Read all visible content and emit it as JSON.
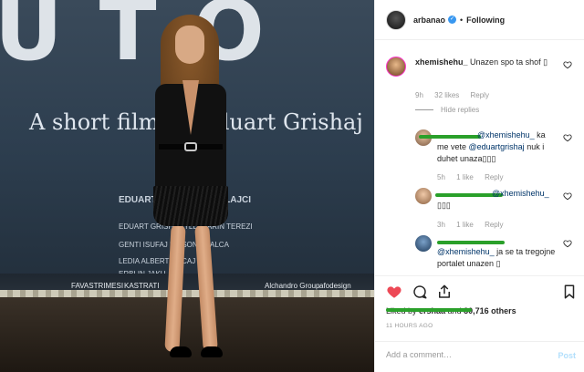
{
  "photo": {
    "banner_text": "A short film by Eduart Grishaj",
    "big_letters": "U T O",
    "credit_a": "EDUART GRISHAJ   CUN LAJCI",
    "credit_b": "EDUART GRISHAJ   YLLI   MARIN TEREZI",
    "credit_c": "GENTI ISUFAJ   EDISON SHALCA",
    "credit_d": "LEDIA   ALBERT KOCAJ",
    "credit_e": "ERBLIN JAKU",
    "sponsors": [
      "FAVASTRIMESI",
      "KASTRATI",
      "Alchandro Group",
      "afodesign"
    ]
  },
  "header": {
    "username": "arbanao",
    "verified_mark": "✓",
    "separator": "•",
    "follow_label": "Following"
  },
  "comments": [
    {
      "user": "xhemishehu_",
      "text": "Unazen spo ta shof",
      "emoji": "▯",
      "time": "9h",
      "likes": "32 likes",
      "reply": "Reply",
      "hide_replies": "Hide replies"
    }
  ],
  "replies": [
    {
      "mention": "@xhemishehu_",
      "text_a": " ka me vete ",
      "mention2": "@eduartgrishaj",
      "text_b": " nuk i duhet unaza",
      "emoji": "▯▯▯",
      "time": "5h",
      "likes": "1 like",
      "reply": "Reply"
    },
    {
      "mention": "@xhemishehu_",
      "emoji": "▯▯▯",
      "time": "3h",
      "likes": "1 like",
      "reply": "Reply"
    },
    {
      "mention": "@xhemishehu_",
      "text": " ja se ta tregojne portalet unazen",
      "emoji": "▯"
    }
  ],
  "likes": {
    "prefix": "Liked by",
    "user": "ershaa",
    "conj": "and",
    "others": "30,716 others"
  },
  "timestamp": "11 HOURS AGO",
  "add_comment": {
    "placeholder": "Add a comment…",
    "post_label": "Post"
  },
  "colors": {
    "like_red": "#ed4956",
    "mention_blue": "#003569",
    "verified_blue": "#3897f0",
    "redaction_green": "#2aa02a"
  }
}
